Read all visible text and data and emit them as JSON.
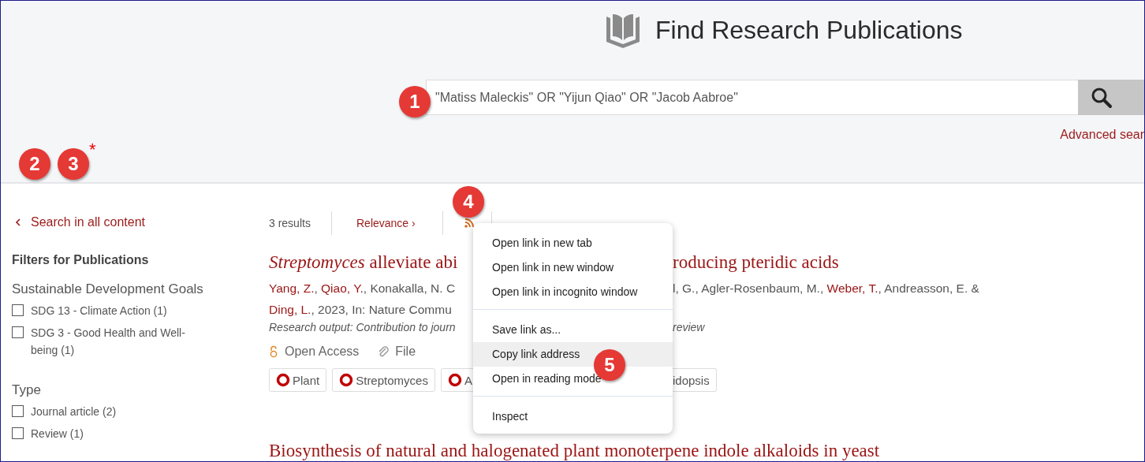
{
  "header": {
    "title": "Find Research Publications",
    "search": {
      "value": "\"Matiss Maleckis\" OR \"Yijun Qiao\" OR \"Jacob Aabroe\""
    },
    "advanced_link": "Advanced sear"
  },
  "sidebar": {
    "back_link": "Search in all content",
    "heading": "Filters for Publications",
    "groups": [
      {
        "title": "Sustainable Development Goals",
        "options": [
          {
            "label": "SDG 13 - Climate Action (1)",
            "checked": false
          },
          {
            "label": "SDG 3 - Good Health and Well-being (1)",
            "checked": false
          }
        ]
      },
      {
        "title": "Type",
        "options": [
          {
            "label": "Journal article (2)",
            "checked": false
          },
          {
            "label": "Review (1)",
            "checked": false
          }
        ]
      }
    ]
  },
  "results": {
    "count": "3 results",
    "sort": "Relevance",
    "sort_caret": "›",
    "item": {
      "title_left": "*Streptomyces* alleviate abi",
      "title_right": "roducing pteridic acids",
      "authors_line1_left": [
        {
          "text": "Yang, Z.",
          "link": true
        },
        {
          "text": ", ",
          "link": false
        },
        {
          "text": "Qiao, Y.",
          "link": true
        },
        {
          "text": ", Konakalla, N. C",
          "link": false
        }
      ],
      "authors_line1_right": [
        {
          "text": "l, G., Agler-Rosenbaum, M., ",
          "link": false
        },
        {
          "text": "Weber, T.",
          "link": true
        },
        {
          "text": ", Andreasson, E. &",
          "link": false
        }
      ],
      "authors_line2_left": [
        {
          "text": "Ding, L.",
          "link": true
        },
        {
          "text": ", 2023, In: Nature Commu",
          "link": false
        }
      ],
      "type_left": "Research output: Contribution to journ",
      "type_right": "review",
      "access": "Open Access",
      "file": "File",
      "keywords_left": [
        {
          "text": "Plant"
        },
        {
          "text": "Streptomyces"
        },
        {
          "text": "A"
        }
      ],
      "keywords_right": [
        {
          "text": "idopsis"
        }
      ]
    },
    "next_title": "Biosynthesis of natural and halogenated plant monoterpene indole alkaloids in yeast"
  },
  "context_menu": [
    [
      {
        "label": "Open link in new tab",
        "selected": false
      },
      {
        "label": "Open link in new window",
        "selected": false
      },
      {
        "label": "Open link in incognito window",
        "selected": false
      }
    ],
    [
      {
        "label": "Save link as...",
        "selected": false
      },
      {
        "label": "Copy link address",
        "selected": true
      },
      {
        "label": "Open in reading mode",
        "selected": false
      }
    ],
    [
      {
        "label": "Inspect",
        "selected": false
      }
    ]
  ],
  "annotations": [
    {
      "kind": "circle",
      "label": "1"
    },
    {
      "kind": "circle",
      "label": "2"
    },
    {
      "kind": "circle",
      "label": "3"
    },
    {
      "kind": "star",
      "label": "*"
    },
    {
      "kind": "circle",
      "label": "4"
    },
    {
      "kind": "circle",
      "label": "5"
    }
  ]
}
